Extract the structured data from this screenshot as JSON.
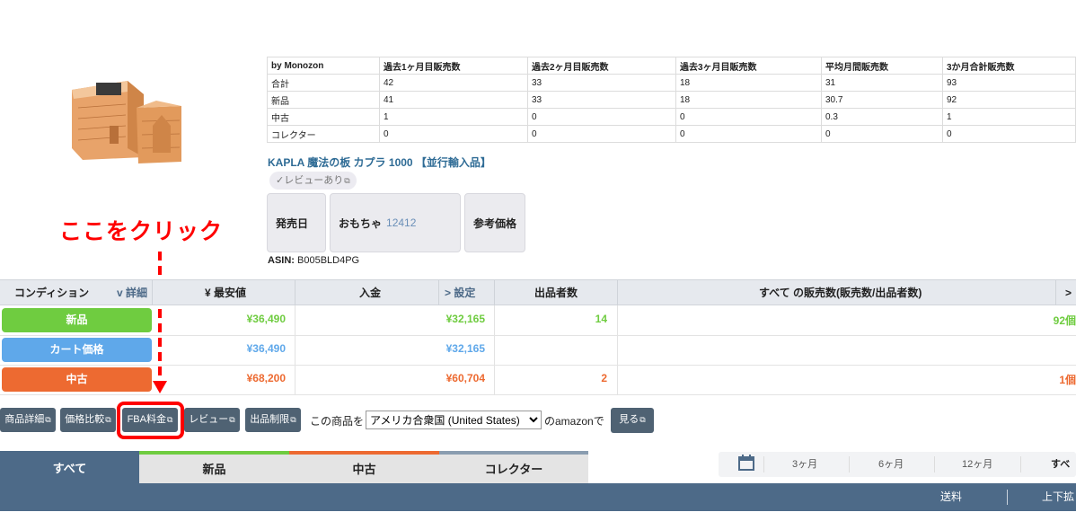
{
  "sales_table": {
    "headers": [
      "by Monozon",
      "過去1ヶ月目販売数",
      "過去2ヶ月目販売数",
      "過去3ヶ月目販売数",
      "平均月間販売数",
      "3か月合計販売数"
    ],
    "rows": [
      [
        "合計",
        "42",
        "33",
        "18",
        "31",
        "93"
      ],
      [
        "新品",
        "41",
        "33",
        "18",
        "30.7",
        "92"
      ],
      [
        "中古",
        "1",
        "0",
        "0",
        "0.3",
        "1"
      ],
      [
        "コレクター",
        "0",
        "0",
        "0",
        "0",
        "0"
      ]
    ]
  },
  "product": {
    "title": "KAPLA 魔法の板 カプラ 1000 【並行輸入品】",
    "review_badge": "✓レビューあり",
    "release_label": "発売日",
    "category_label": "おもちゃ",
    "category_rank": "12412",
    "ref_price_label": "参考価格",
    "asin_label": "ASIN:",
    "asin": "B005BLD4PG"
  },
  "annotation": {
    "text": "ここをクリック",
    "color": "#ff0000"
  },
  "price_table": {
    "header": {
      "condition": "コンディション",
      "detail": "v 詳細",
      "lowest": "¥ 最安値",
      "deposit": "入金",
      "settings": "> 設定",
      "sellers": "出品者数",
      "sales_all": "すべて の販売数(販売数/出品者数)",
      "more": ">"
    },
    "rows": [
      {
        "condition": "新品",
        "lowest": "¥36,490",
        "deposit": "¥32,165",
        "sellers": "14",
        "sales": "92個",
        "color": "#6fcc40"
      },
      {
        "condition": "カート価格",
        "lowest": "¥36,490",
        "deposit": "¥32,165",
        "sellers": "",
        "sales": "",
        "color": "#5fa8ea"
      },
      {
        "condition": "中古",
        "lowest": "¥68,200",
        "deposit": "¥60,704",
        "sellers": "2",
        "sales": "1個",
        "color": "#ed6a31"
      }
    ]
  },
  "toolbar": {
    "buttons": [
      "商品詳細",
      "価格比較",
      "FBA料金",
      "レビュー",
      "出品制限"
    ],
    "ext_icon": "external-link-icon",
    "country_label": "この商品を",
    "country_selected": "アメリカ合衆国 (United States)",
    "amazon_label": "のamazonで",
    "view_button": "見る"
  },
  "tabs": [
    "すべて",
    "新品",
    "中古",
    "コレクター"
  ],
  "range": {
    "icon": "calendar-icon",
    "options": [
      "3ヶ月",
      "6ヶ月",
      "12ヶ月",
      "すべて"
    ]
  },
  "bottom_bar": {
    "shipping": "送料",
    "expand": "上下拡"
  }
}
